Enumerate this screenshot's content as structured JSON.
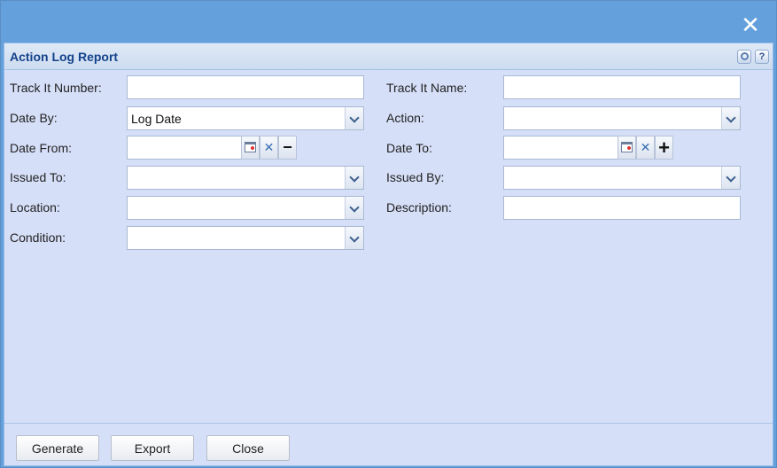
{
  "panel": {
    "title": "Action Log Report"
  },
  "icons": {
    "close": "close-icon",
    "gear": "gear-icon",
    "help": "help-icon"
  },
  "help_glyph": "?",
  "close_glyph": "✕",
  "fields": {
    "track_it_number": {
      "label": "Track It Number:",
      "value": ""
    },
    "track_it_name": {
      "label": "Track It Name:",
      "value": ""
    },
    "date_by": {
      "label": "Date By:",
      "value": "Log Date"
    },
    "action": {
      "label": "Action:",
      "value": ""
    },
    "date_from": {
      "label": "Date From:",
      "value": ""
    },
    "date_to": {
      "label": "Date To:",
      "value": ""
    },
    "issued_to": {
      "label": "Issued To:",
      "value": ""
    },
    "issued_by": {
      "label": "Issued By:",
      "value": ""
    },
    "location": {
      "label": "Location:",
      "value": ""
    },
    "description": {
      "label": "Description:",
      "value": ""
    },
    "condition": {
      "label": "Condition:",
      "value": ""
    }
  },
  "glyphs": {
    "clear": "✕",
    "minus": "−",
    "plus": "+"
  },
  "buttons": {
    "generate": "Generate",
    "export": "Export",
    "close": "Close"
  }
}
